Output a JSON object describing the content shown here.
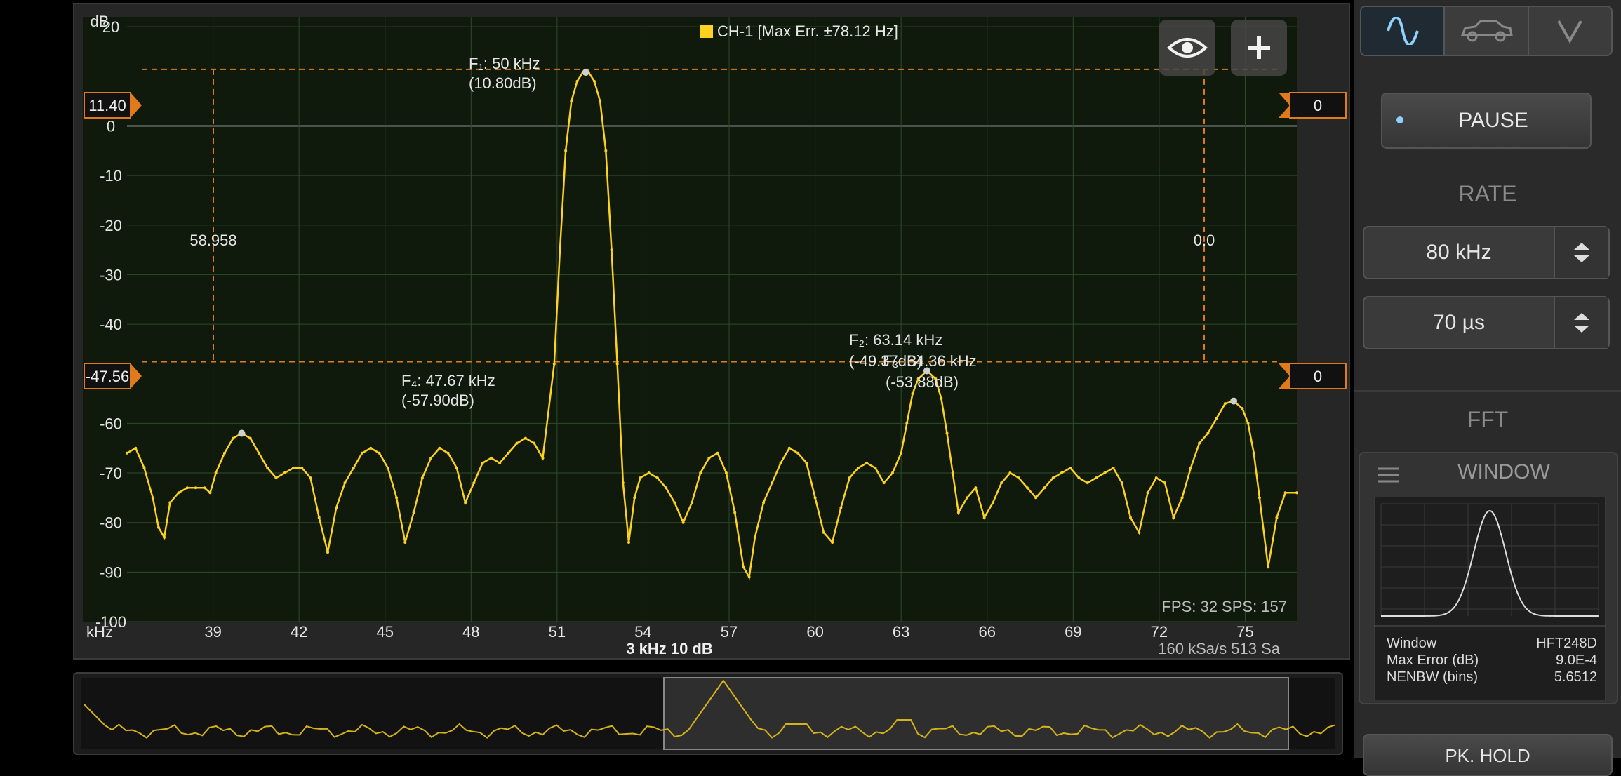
{
  "channel": {
    "label": "CH-1 [Max Err. ±78.12 Hz]",
    "color": "#ffd21f"
  },
  "axes": {
    "y_unit": "dB",
    "y_ticks": [
      "20",
      "0",
      "-10",
      "-20",
      "-30",
      "-40",
      "-60",
      "-70",
      "-80",
      "-90",
      "-100"
    ],
    "x_unit": "kHz",
    "x_ticks": [
      "39",
      "42",
      "45",
      "48",
      "51",
      "54",
      "57",
      "60",
      "63",
      "66",
      "69",
      "72",
      "75"
    ],
    "scale_text": "3 kHz  10 dB",
    "sample_text": "160 kSa/s   513 Sa",
    "fps_text": "FPS: 32  SPS: 157"
  },
  "cursors": {
    "upper_level": "11.40",
    "lower_level": "-47.56",
    "upper_right": "0",
    "lower_right": "0",
    "left_freq": "58.958",
    "right_freq": "0.0"
  },
  "peaks": {
    "f1_freq": "F₁: 50 kHz",
    "f1_db": "(10.80dB)",
    "f2_freq": "F₂: 63.14 kHz",
    "f2_db": "(-49.37dB)",
    "f3_freq": "F₃: 64.36 kHz",
    "f3_db": "(-53.88dB)",
    "f4_freq": "F₄: 47.67 kHz",
    "f4_db": "(-57.90dB)"
  },
  "panel": {
    "pause_label": "PAUSE",
    "rate_label": "RATE",
    "rate_value": "80 kHz",
    "time_value": "70 µs",
    "fft_label": "FFT",
    "window_label": "WINDOW",
    "window_rows": [
      {
        "k": "Window",
        "v": "HFT248D"
      },
      {
        "k": "Max Error (dB)",
        "v": "9.0E-4"
      },
      {
        "k": "NENBW (bins)",
        "v": "5.6512"
      }
    ],
    "pk_hold_label": "PK. HOLD"
  },
  "icons": {
    "mode_scope": "sine-wave-icon",
    "mode_car": "car-icon",
    "mode_v": "chevron-v-icon",
    "eye": "eye-icon",
    "plus": "plus-icon"
  },
  "chart_data": {
    "type": "line",
    "xlabel": "kHz",
    "ylabel": "dB",
    "xlim": [
      36,
      76.8
    ],
    "ylim": [
      -100,
      22
    ],
    "series": [
      {
        "name": "CH-1",
        "points": [
          [
            36.0,
            -66
          ],
          [
            36.3,
            -65
          ],
          [
            36.6,
            -69
          ],
          [
            36.9,
            -75
          ],
          [
            37.1,
            -81
          ],
          [
            37.3,
            -83
          ],
          [
            37.5,
            -76
          ],
          [
            37.8,
            -74
          ],
          [
            38.1,
            -73
          ],
          [
            38.4,
            -73
          ],
          [
            38.7,
            -73
          ],
          [
            38.9,
            -74
          ],
          [
            39.1,
            -70
          ],
          [
            39.4,
            -66
          ],
          [
            39.7,
            -63
          ],
          [
            40.0,
            -62
          ],
          [
            40.3,
            -63
          ],
          [
            40.6,
            -66
          ],
          [
            40.9,
            -69
          ],
          [
            41.2,
            -71
          ],
          [
            41.5,
            -70
          ],
          [
            41.8,
            -69
          ],
          [
            42.1,
            -69
          ],
          [
            42.4,
            -71
          ],
          [
            42.7,
            -79
          ],
          [
            43.0,
            -86
          ],
          [
            43.3,
            -77
          ],
          [
            43.6,
            -72
          ],
          [
            43.9,
            -69
          ],
          [
            44.2,
            -66
          ],
          [
            44.5,
            -65
          ],
          [
            44.8,
            -66
          ],
          [
            45.1,
            -69
          ],
          [
            45.4,
            -75
          ],
          [
            45.7,
            -84
          ],
          [
            46.0,
            -78
          ],
          [
            46.3,
            -71
          ],
          [
            46.6,
            -67
          ],
          [
            46.9,
            -65
          ],
          [
            47.2,
            -66
          ],
          [
            47.5,
            -69
          ],
          [
            47.8,
            -76
          ],
          [
            48.1,
            -72
          ],
          [
            48.4,
            -68
          ],
          [
            48.7,
            -67
          ],
          [
            49.0,
            -68
          ],
          [
            49.3,
            -66
          ],
          [
            49.6,
            -64
          ],
          [
            49.9,
            -63
          ],
          [
            50.2,
            -64
          ],
          [
            50.5,
            -67
          ],
          [
            50.9,
            -48
          ],
          [
            51.1,
            -25
          ],
          [
            51.3,
            -5
          ],
          [
            51.5,
            5
          ],
          [
            51.7,
            9
          ],
          [
            51.9,
            10.8
          ],
          [
            52.1,
            10.8
          ],
          [
            52.3,
            9
          ],
          [
            52.5,
            5
          ],
          [
            52.7,
            -5
          ],
          [
            52.9,
            -25
          ],
          [
            53.1,
            -48
          ],
          [
            53.3,
            -72
          ],
          [
            53.5,
            -84
          ],
          [
            53.7,
            -75
          ],
          [
            53.9,
            -71
          ],
          [
            54.2,
            -70
          ],
          [
            54.5,
            -71
          ],
          [
            54.8,
            -73
          ],
          [
            55.1,
            -76
          ],
          [
            55.4,
            -80
          ],
          [
            55.7,
            -76
          ],
          [
            56.0,
            -70
          ],
          [
            56.3,
            -67
          ],
          [
            56.6,
            -66
          ],
          [
            56.9,
            -70
          ],
          [
            57.2,
            -78
          ],
          [
            57.5,
            -89
          ],
          [
            57.7,
            -91
          ],
          [
            57.9,
            -83
          ],
          [
            58.2,
            -76
          ],
          [
            58.5,
            -72
          ],
          [
            58.8,
            -68
          ],
          [
            59.1,
            -65
          ],
          [
            59.4,
            -66
          ],
          [
            59.7,
            -68
          ],
          [
            60.0,
            -75
          ],
          [
            60.3,
            -82
          ],
          [
            60.6,
            -84
          ],
          [
            60.9,
            -77
          ],
          [
            61.2,
            -71
          ],
          [
            61.5,
            -69
          ],
          [
            61.8,
            -68
          ],
          [
            62.1,
            -69
          ],
          [
            62.4,
            -72
          ],
          [
            62.7,
            -70
          ],
          [
            63.0,
            -66
          ],
          [
            63.2,
            -60
          ],
          [
            63.4,
            -54
          ],
          [
            63.6,
            -51
          ],
          [
            63.9,
            -49.4
          ],
          [
            64.2,
            -51
          ],
          [
            64.4,
            -55
          ],
          [
            64.6,
            -62
          ],
          [
            64.8,
            -70
          ],
          [
            65.0,
            -78
          ],
          [
            65.3,
            -75
          ],
          [
            65.6,
            -73
          ],
          [
            65.9,
            -79
          ],
          [
            66.2,
            -76
          ],
          [
            66.5,
            -72
          ],
          [
            66.8,
            -70
          ],
          [
            67.1,
            -71
          ],
          [
            67.4,
            -73
          ],
          [
            67.7,
            -75
          ],
          [
            68.0,
            -73
          ],
          [
            68.3,
            -71
          ],
          [
            68.6,
            -70
          ],
          [
            68.9,
            -69
          ],
          [
            69.2,
            -71
          ],
          [
            69.5,
            -72
          ],
          [
            69.8,
            -71
          ],
          [
            70.1,
            -70
          ],
          [
            70.4,
            -69
          ],
          [
            70.7,
            -72
          ],
          [
            71.0,
            -79
          ],
          [
            71.3,
            -82
          ],
          [
            71.6,
            -74
          ],
          [
            71.9,
            -71
          ],
          [
            72.2,
            -72
          ],
          [
            72.5,
            -79
          ],
          [
            72.8,
            -75
          ],
          [
            73.1,
            -69
          ],
          [
            73.4,
            -64
          ],
          [
            73.7,
            -62
          ],
          [
            74.0,
            -59
          ],
          [
            74.3,
            -56
          ],
          [
            74.6,
            -55.5
          ],
          [
            74.9,
            -57
          ],
          [
            75.1,
            -60
          ],
          [
            75.3,
            -66
          ],
          [
            75.5,
            -75
          ],
          [
            75.8,
            -89
          ],
          [
            76.1,
            -79
          ],
          [
            76.4,
            -74
          ],
          [
            76.8,
            -74
          ]
        ]
      }
    ]
  }
}
